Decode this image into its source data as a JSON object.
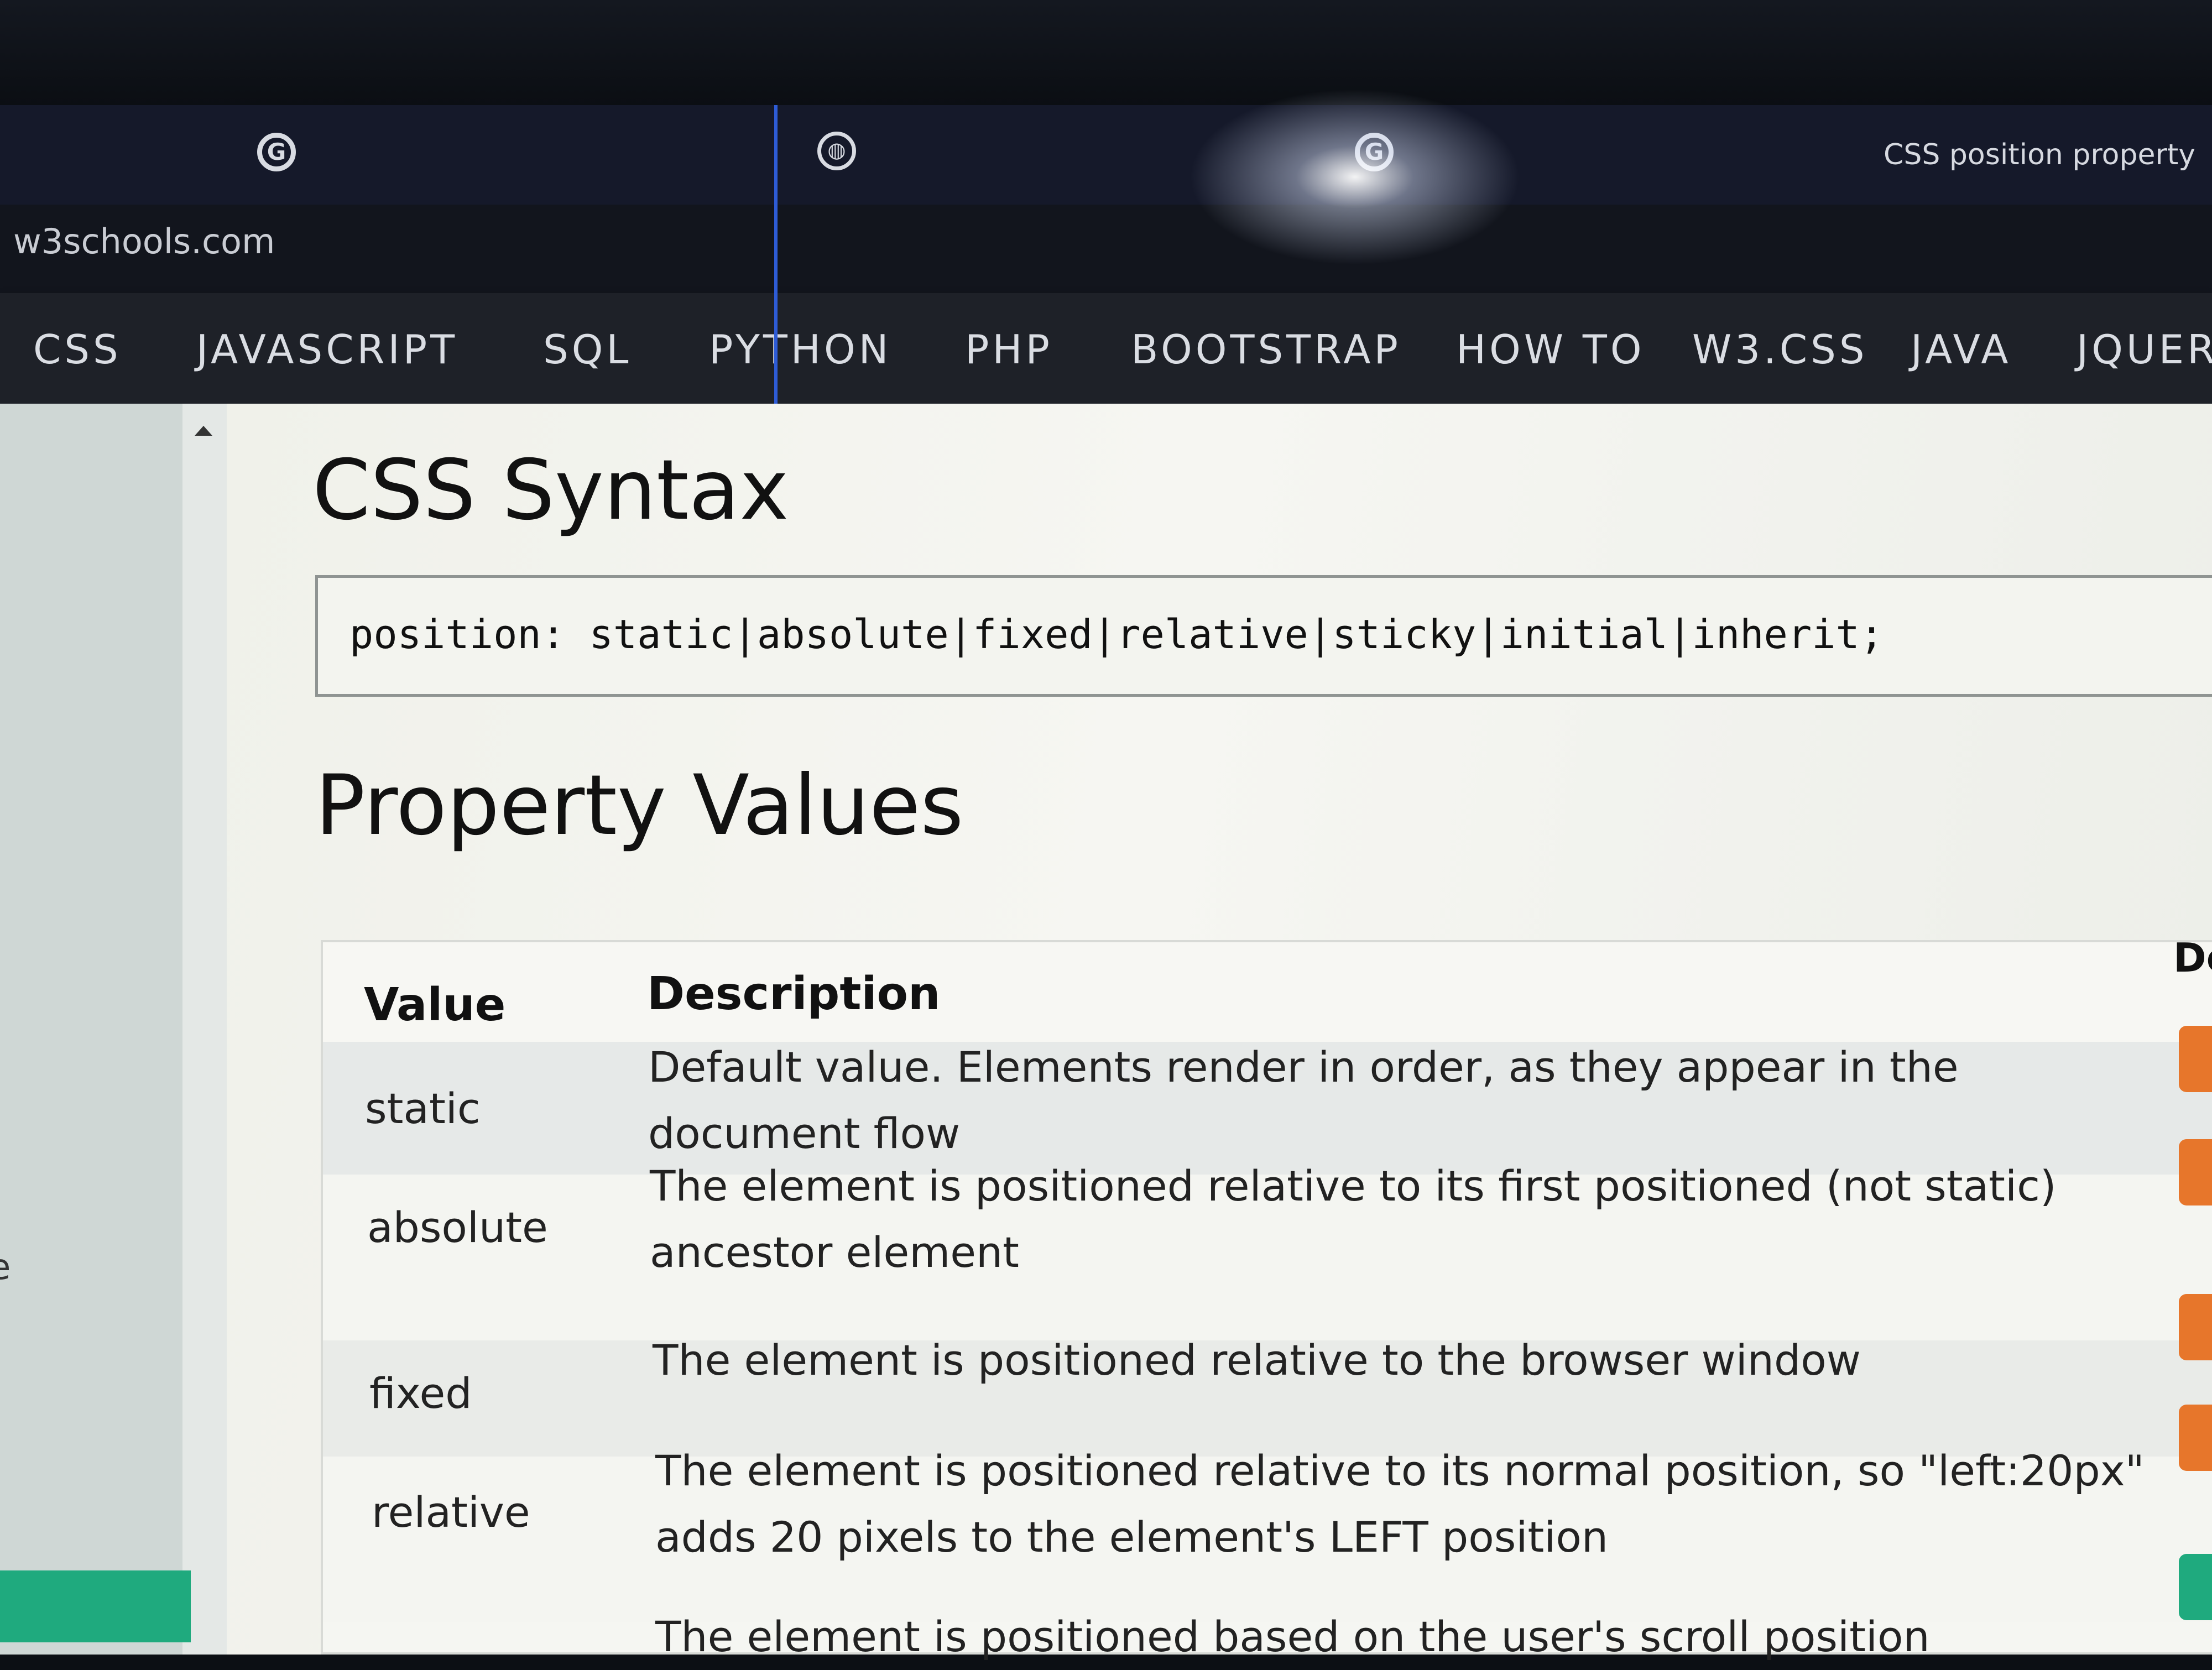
{
  "browser": {
    "tabs": [
      {
        "icon": "google-icon",
        "glyph": "G"
      },
      {
        "icon": "globe-icon",
        "glyph": "◍"
      },
      {
        "icon": "google-icon",
        "glyph": "G"
      }
    ],
    "active_tab_title": "CSS position property",
    "address": "w3schools.com"
  },
  "topnav": {
    "items": [
      "CSS",
      "JAVASCRIPT",
      "SQL",
      "PYTHON",
      "PHP",
      "BOOTSTRAP",
      "HOW TO",
      "W3.CSS",
      "JAVA",
      "JQUERY"
    ]
  },
  "content": {
    "syntax_heading": "CSS Syntax",
    "syntax_code": "position: static|absolute|fixed|relative|sticky|initial|inherit;",
    "values_heading": "Property Values",
    "table": {
      "headers": [
        "Value",
        "Description",
        "De"
      ],
      "rows": [
        {
          "value": "static",
          "description": "Default value. Elements render in order, as they appear in the document flow"
        },
        {
          "value": "absolute",
          "description": "The element is positioned relative to its first positioned (not static) ancestor element"
        },
        {
          "value": "fixed",
          "description": "The element is positioned relative to the browser window"
        },
        {
          "value": "relative",
          "description": "The element is positioned relative to its normal position, so \"left:20px\" adds 20 pixels to the element's LEFT position"
        },
        {
          "value": "",
          "description": "The element is positioned based on the user's scroll position"
        }
      ]
    }
  },
  "sidebar": {
    "edge_char": "e"
  },
  "colors": {
    "accent_green": "#1faa7e",
    "try_button_orange": "#e7762b",
    "nav_bg": "#1e2128",
    "tab_divider_blue": "#2e5cd6"
  }
}
